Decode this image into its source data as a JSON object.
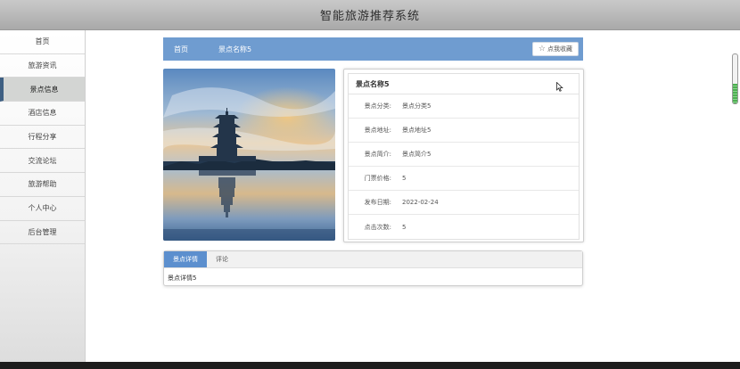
{
  "app": {
    "title": "智能旅游推荐系统"
  },
  "sidebar": {
    "items": [
      {
        "label": "首页",
        "active": false
      },
      {
        "label": "旅游资讯",
        "active": false
      },
      {
        "label": "景点信息",
        "active": true
      },
      {
        "label": "酒店信息",
        "active": false
      },
      {
        "label": "行程分享",
        "active": false
      },
      {
        "label": "交流论坛",
        "active": false
      },
      {
        "label": "旅游帮助",
        "active": false
      },
      {
        "label": "个人中心",
        "active": false
      },
      {
        "label": "后台管理",
        "active": false
      }
    ]
  },
  "breadcrumb": {
    "home": "首页",
    "current": "景点名称5"
  },
  "favorite": {
    "label": "点我收藏",
    "icon": "star-outline-icon"
  },
  "spot": {
    "name": "景点名称5",
    "rows": [
      {
        "label": "景点分类:",
        "value": "景点分类5"
      },
      {
        "label": "景点地址:",
        "value": "景点地址5"
      },
      {
        "label": "景点简介:",
        "value": "景点简介5"
      },
      {
        "label": "门票价格:",
        "value": "5"
      },
      {
        "label": "发布日期:",
        "value": "2022-02-24"
      },
      {
        "label": "点击次数:",
        "value": "5"
      }
    ]
  },
  "detail": {
    "tabs": [
      {
        "label": "景点详情",
        "active": true
      },
      {
        "label": "评论",
        "active": false
      }
    ],
    "content": "景点详情5"
  },
  "colors": {
    "accent": "#6f9cd0",
    "tab_active": "#5c8fce",
    "sidebar_active_border": "#3e5f82"
  }
}
